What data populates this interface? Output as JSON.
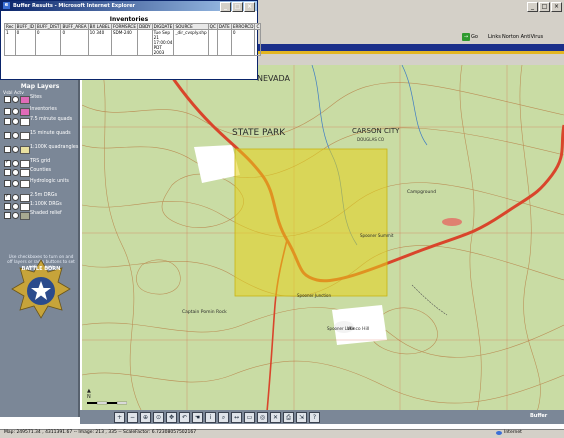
{
  "popup": {
    "window_title": "Buffer Results - Microsoft Internet Explorer",
    "table_title": "Inventories",
    "columns": [
      "Rec",
      "BUFF_ID",
      "BUFF_DIST",
      "BUFF_AREA",
      "BX LABEL",
      "FORMSRCE",
      "DBDY",
      "DIGDATE",
      "SOURCE",
      "QC",
      "DATE",
      "ERRORCD",
      "C"
    ],
    "rows": [
      [
        "1",
        "0",
        "0",
        "0",
        "10 340",
        "SDM-240",
        "",
        "Tue Sep 21 17:00:04 PDT 2003",
        "_dir_cvsply.shp",
        "",
        "",
        "0",
        ""
      ]
    ]
  },
  "browser": {
    "go_label": "Go",
    "links_label": "Links",
    "norton_label": "Norton AntiVirus",
    "min_symbol": "_",
    "max_symbol": "□",
    "close_symbol": "×",
    "status_text": "Map: 249571.34 , 4311391.67 -- Image: 213 , 335 -- ScaleFactor: 6.72308057502167",
    "zone": "Internet"
  },
  "left_panel": {
    "title": "Map Layers",
    "visible_label": "Vsbl Actv",
    "layers": [
      {
        "label": "Sites",
        "checked": false,
        "swatch": "#e06bb8"
      },
      {
        "label": "Inventories",
        "checked": false,
        "swatch": "#e06bb8"
      },
      {
        "label": "7.5 minute quads",
        "checked": false,
        "swatch": "#ffffff"
      },
      {
        "label": "15 minute quads",
        "checked": false,
        "swatch": "#ffffff"
      },
      {
        "label": "1:100K quadrangles",
        "checked": false,
        "swatch": "#e8e0a0"
      },
      {
        "label": "TRS grid",
        "checked": true,
        "swatch": "#ffffff"
      },
      {
        "label": "Counties",
        "checked": false,
        "swatch": "#ffffff"
      },
      {
        "label": "Hydrologic units",
        "checked": false,
        "swatch": "#ffffff"
      },
      {
        "label": "2.5m DRGs",
        "checked": true,
        "swatch": "#ffffff"
      },
      {
        "label": "1:100K DRGs",
        "checked": false,
        "swatch": "#ffffff"
      },
      {
        "label": "Shaded relief",
        "checked": false,
        "swatch": "#a8a890"
      }
    ],
    "help_text": "Use checkboxes to turn on and off layers or radio buttons to set active layer",
    "seal_text": "BATTLE BORN"
  },
  "map": {
    "labels": [
      {
        "text": "NEVADA",
        "name": "state-label"
      },
      {
        "text": "STATE PARK",
        "name": "park-label"
      },
      {
        "text": "CARSON CITY",
        "name": "city-label"
      },
      {
        "text": "DOUGLAS CO",
        "name": "county-label"
      },
      {
        "text": "Campground",
        "name": "campground-label"
      },
      {
        "text": "Spooner Summit",
        "name": "summit-label"
      },
      {
        "text": "Spooner Junction",
        "name": "junction-label"
      },
      {
        "text": "Captain Pomin Rock",
        "name": "rock-label"
      },
      {
        "text": "Spooner Lake",
        "name": "lake-label"
      },
      {
        "text": "Winco Hill",
        "name": "hill-label"
      }
    ],
    "north_label": "N"
  },
  "toolbar": {
    "tools": [
      "zoom-in-icon",
      "zoom-out-icon",
      "zoom-full-icon",
      "zoom-active-icon",
      "pan-icon",
      "back-icon",
      "hand-icon",
      "identify-icon",
      "find-icon",
      "measure-icon",
      "select-icon",
      "buffer-icon",
      "clear-icon",
      "print-icon",
      "export-icon",
      "help-icon"
    ],
    "buffer_label": "Buffer"
  },
  "colors": {
    "highway": "#d9452b",
    "buffer_overlay": "#e6d21a",
    "terrain": "#c7dba2",
    "contour": "#b8834a",
    "banner": "#1a2f8a"
  }
}
